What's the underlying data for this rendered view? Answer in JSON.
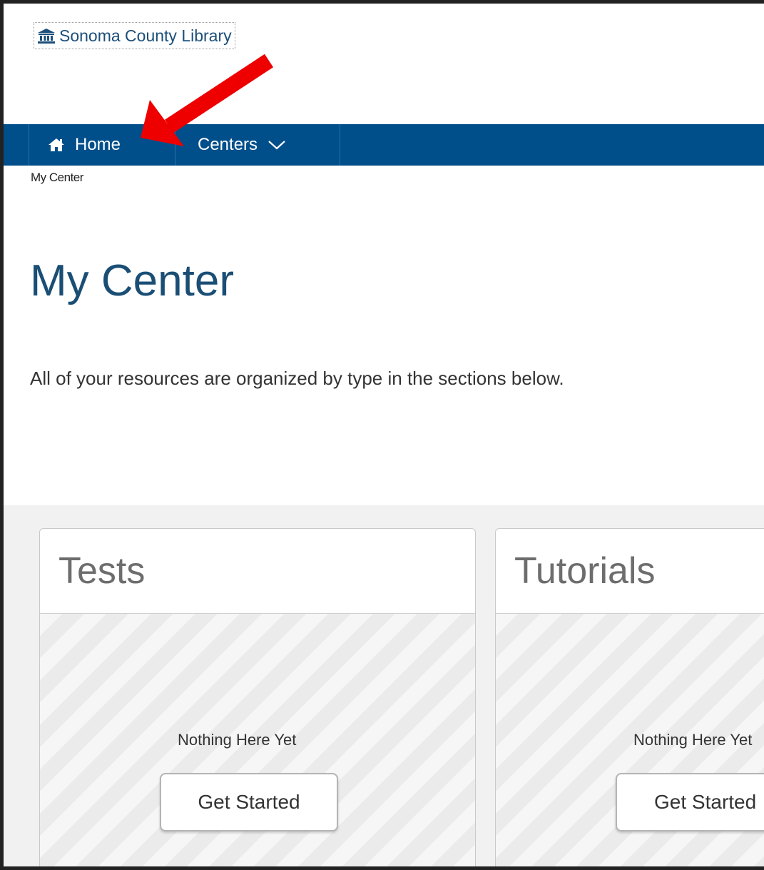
{
  "header": {
    "logo_text": "Sonoma County Library",
    "logo_icon": "library-building-icon"
  },
  "nav": {
    "items": [
      {
        "label": "Home",
        "icon": "home-icon"
      },
      {
        "label": "Centers",
        "icon": "chevron-down-icon"
      }
    ]
  },
  "breadcrumb": "My Center",
  "page": {
    "title": "My Center",
    "description": "All of your resources are organized by type in the sections below."
  },
  "cards": [
    {
      "title": "Tests",
      "empty_text": "Nothing Here Yet",
      "button_label": "Get Started"
    },
    {
      "title": "Tutorials",
      "empty_text": "Nothing Here Yet",
      "button_label": "Get Started"
    }
  ],
  "annotation": {
    "type": "arrow",
    "color": "#ee0000",
    "points_to": "Home"
  },
  "colors": {
    "nav_background": "#004f8b",
    "title": "#1a4e75",
    "logo": "#1b4f7a"
  }
}
